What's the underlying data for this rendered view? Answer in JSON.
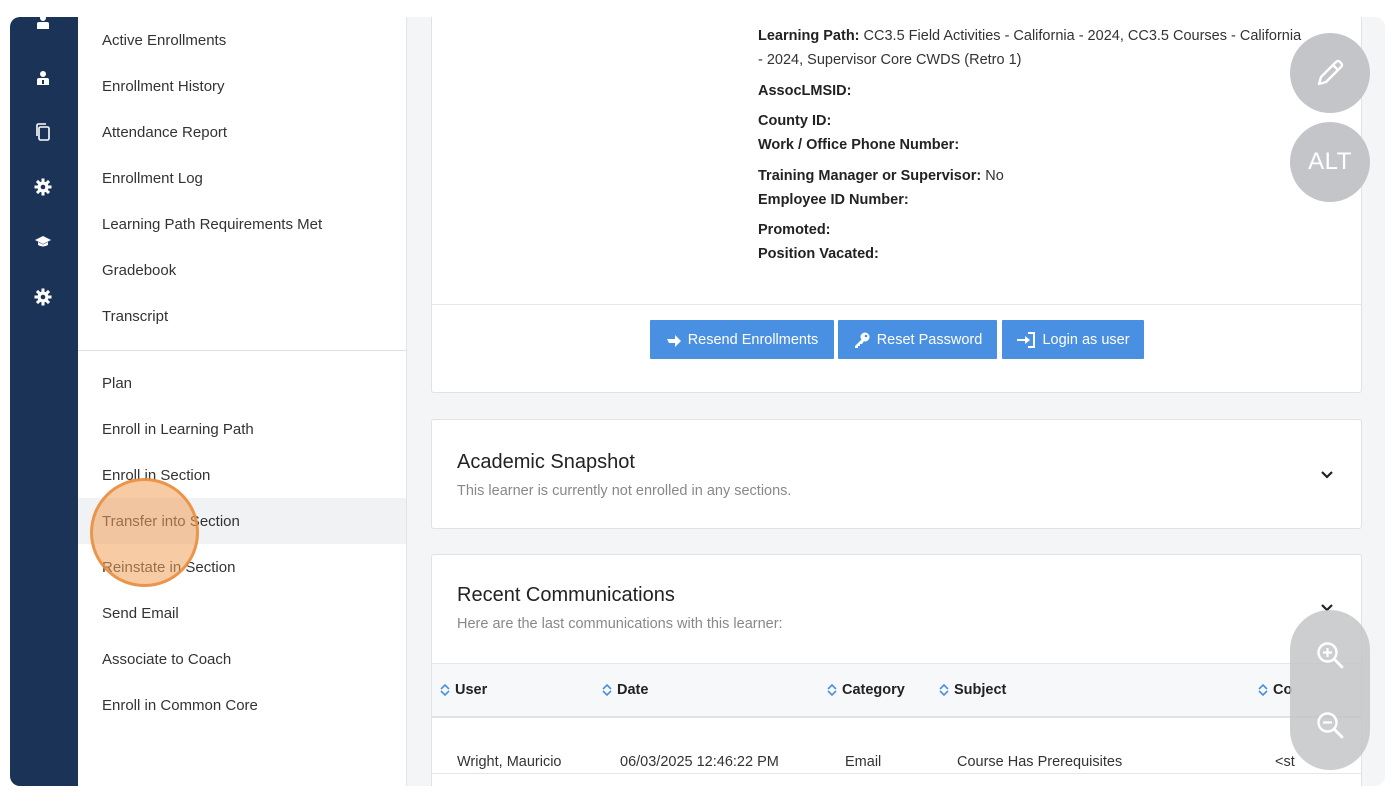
{
  "sidebar": {
    "group1": [
      {
        "label": "Active Enrollments"
      },
      {
        "label": "Enrollment History"
      },
      {
        "label": "Attendance Report"
      },
      {
        "label": "Enrollment Log"
      },
      {
        "label": "Learning Path Requirements Met"
      },
      {
        "label": "Gradebook"
      },
      {
        "label": "Transcript"
      }
    ],
    "group2": [
      {
        "label": "Plan"
      },
      {
        "label": "Enroll in Learning Path"
      },
      {
        "label": "Enroll in Section"
      },
      {
        "label": "Transfer into Section",
        "active": true
      },
      {
        "label": "Reinstate in Section"
      },
      {
        "label": "Send Email"
      },
      {
        "label": "Associate to Coach"
      },
      {
        "label": "Enroll in Common Core"
      }
    ]
  },
  "profile": {
    "learning_path_label": "Learning Path:",
    "learning_path_line1": "CC3.5 Field Activities - California - 2024, CC3.5 Courses - California",
    "learning_path_line2": "- 2024, Supervisor Core CWDS (Retro 1)",
    "assoc_lms_label": "AssocLMSID:",
    "county_label": "County ID:",
    "phone_label": "Work / Office Phone Number:",
    "manager_label": "Training Manager or Supervisor:",
    "manager_value": "No",
    "employee_id_label": "Employee ID Number:",
    "promoted_label": "Promoted:",
    "vacated_label": "Position Vacated:"
  },
  "actions": {
    "resend": "Resend Enrollments",
    "reset": "Reset Password",
    "login": "Login as user"
  },
  "snapshot": {
    "title": "Academic Snapshot",
    "subtitle": "This learner is currently not enrolled in any sections."
  },
  "communications": {
    "title": "Recent Communications",
    "subtitle": "Here are the last communications with this learner:",
    "columns": [
      "User",
      "Date",
      "Category",
      "Subject",
      "Co"
    ],
    "rows": [
      [
        "Wright, Mauricio",
        "06/03/2025 12:46:22 PM",
        "Email",
        "Course Has Prerequisites",
        "<st"
      ]
    ]
  },
  "floating": {
    "alt_label": "ALT"
  },
  "colors": {
    "rail": "#1c3358",
    "button": "#4a90e2",
    "sort_icon": "#4a90e2"
  }
}
